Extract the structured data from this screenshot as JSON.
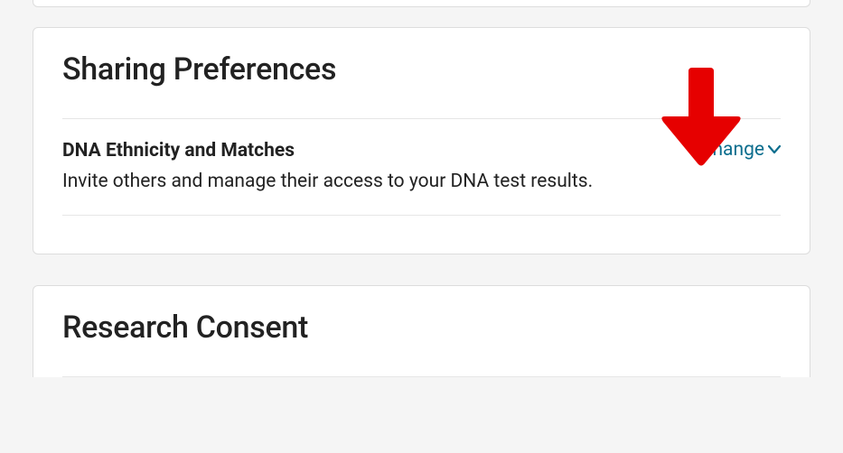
{
  "cards": {
    "sharing": {
      "title": "Sharing Preferences",
      "setting": {
        "title": "DNA Ethnicity and Matches",
        "description": "Invite others and manage their access to your DNA test results.",
        "action_label": "Change"
      }
    },
    "research": {
      "title": "Research Consent"
    }
  },
  "annotation": {
    "arrow_color": "#e60000"
  }
}
